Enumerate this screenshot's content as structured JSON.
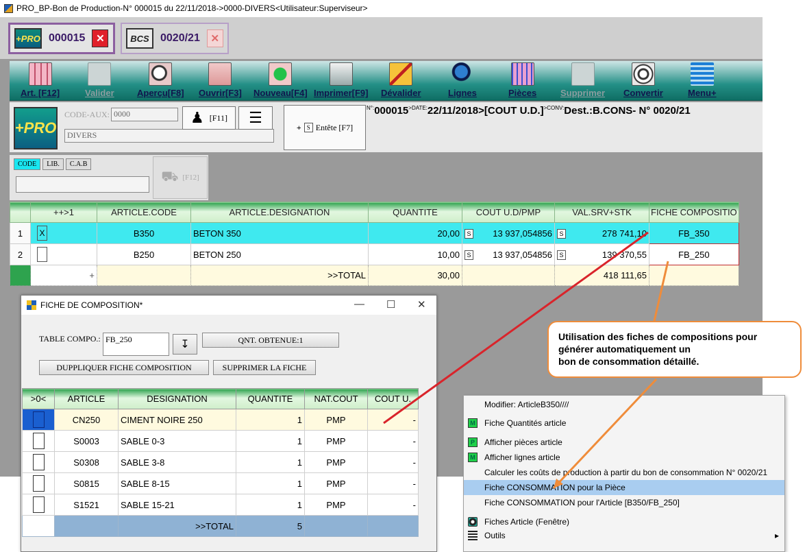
{
  "window_title": "PRO_BP-Bon de Production-N° 000015 du 22/11/2018->0000-DIVERS<Utilisateur:Superviseur>",
  "doc_tabs": [
    {
      "badge": "+PRO",
      "number": "000015",
      "close": "✕"
    },
    {
      "badge": "BCS",
      "number": "0020/21",
      "close": "✕"
    }
  ],
  "toolbar": [
    {
      "label": "Art. [F12]",
      "icon": "article-grid-icon",
      "disabled": false
    },
    {
      "label": "Valider",
      "icon": "validate-icon",
      "disabled": true
    },
    {
      "label": "Aperçu[F8]",
      "icon": "preview-magnifier-icon",
      "disabled": false
    },
    {
      "label": "Ouvrir[F3]",
      "icon": "open-arrow-icon",
      "disabled": false
    },
    {
      "label": "Nouveau[F4]",
      "icon": "new-plus-icon",
      "disabled": false
    },
    {
      "label": "Imprimer[F9]",
      "icon": "printer-icon",
      "disabled": false
    },
    {
      "label": "Dévalider",
      "icon": "unvalidate-icon",
      "disabled": false
    },
    {
      "label": "Lignes",
      "icon": "magnifier-icon",
      "disabled": false
    },
    {
      "label": "Pièces",
      "icon": "grid-table-icon",
      "disabled": false
    },
    {
      "label": "Supprimer",
      "icon": "delete-icon",
      "disabled": true
    },
    {
      "label": "Convertir",
      "icon": "convert-icon",
      "disabled": false
    },
    {
      "label": "Menu+",
      "icon": "menu-lines-icon",
      "disabled": false
    }
  ],
  "header": {
    "logo": "+PRO",
    "code_aux_label": "CODE-AUX:",
    "code_aux_value": "0000",
    "client_name": "DIVERS",
    "f11_label": "[F11]",
    "entete_label": "Entête [F7]",
    "s_label": "S",
    "plus_label": "+"
  },
  "info_line": {
    "no_label": "N°:",
    "no_value": "000015",
    "date_label": ">DATE:",
    "date_value": "22/11/2018",
    "cost_label": ">[COUT U.D.]",
    "conv_label": ">CONV:",
    "conv_value": "Dest.:B.CONS- N° 0020/21"
  },
  "filter": {
    "tabs": [
      "CODE",
      "LIB.",
      "C.A.B"
    ],
    "active": "CODE",
    "f12_label": "[F12]"
  },
  "grid": {
    "headers": [
      "",
      "++>1",
      "ARTICLE.CODE",
      "ARTICLE.DESIGNATION",
      "QUANTITE",
      "COUT U.D/PMP",
      "VAL.SRV+STK",
      "FICHE COMPOSITIO"
    ],
    "rows": [
      {
        "num": "1",
        "check": "X",
        "code": "B350",
        "designation": "BETON 350",
        "quantite": "20,00",
        "cout": "13 937,054856",
        "val": "278 741,10",
        "fiche": "FB_350"
      },
      {
        "num": "2",
        "check": "",
        "code": "B250",
        "designation": "BETON 250",
        "quantite": "10,00",
        "cout": "13 937,054856",
        "val": "139 370,55",
        "fiche": "FB_250"
      }
    ],
    "total": {
      "label": ">>TOTAL",
      "quantite": "30,00",
      "val": "418 111,65"
    },
    "s_mark": "S"
  },
  "compo_window": {
    "title": "FICHE DE COMPOSITION*",
    "min": "—",
    "max": "☐",
    "close": "✕",
    "table_label": "TABLE COMPO.:",
    "table_value": "FB_250",
    "qnt_obtenue": "QNT. OBTENUE:1",
    "dup_button": "DUPPLIQUER FICHE COMPOSITION",
    "del_button": "SUPPRIMER LA FICHE",
    "headers": [
      ">0<",
      "ARTICLE",
      "DESIGNATION",
      "QUANTITE",
      "NAT.COUT",
      "COUT U."
    ],
    "rows": [
      {
        "article": "CN250",
        "designation": "CIMENT NOIRE 250",
        "quantite": "1",
        "nat": "PMP",
        "cout": "-"
      },
      {
        "article": "S0003",
        "designation": "SABLE 0-3",
        "quantite": "1",
        "nat": "PMP",
        "cout": "-"
      },
      {
        "article": "S0308",
        "designation": "SABLE 3-8",
        "quantite": "1",
        "nat": "PMP",
        "cout": "-"
      },
      {
        "article": "S0815",
        "designation": "SABLE 8-15",
        "quantite": "1",
        "nat": "PMP",
        "cout": "-"
      },
      {
        "article": "S1521",
        "designation": "SABLE 15-21",
        "quantite": "1",
        "nat": "PMP",
        "cout": "-"
      }
    ],
    "total_label": ">>TOTAL",
    "total_value": "5"
  },
  "callout": "Utilisation des fiches de compositions pour\ngénérer automatiquement un\n bon de consommation détaillé.",
  "context_menu": [
    {
      "label": "Modifier: ArticleB350////",
      "icon": ""
    },
    {
      "label": "Fiche Quantités article",
      "icon": "M"
    },
    {
      "label": "Afficher pièces article",
      "icon": "P"
    },
    {
      "label": "Afficher lignes article",
      "icon": "M"
    },
    {
      "label": "Calculer les coûts de production à partir du bon de consommation N° 0020/21",
      "icon": ""
    },
    {
      "label": "Fiche CONSOMMATION pour la Pièce",
      "icon": "",
      "highlight": true
    },
    {
      "label": "Fiche CONSOMMATION pour l'Article [B350/FB_250]",
      "icon": ""
    },
    {
      "label": "Fiches Article (Fenêtre)",
      "icon": "eye"
    },
    {
      "label": "Outils",
      "icon": "lines",
      "submenu": "▸"
    }
  ],
  "colors": {
    "accent_teal": "#238f86",
    "selection_cyan": "#3fe9ef",
    "callout_orange": "#ef8c3a",
    "arrow_red": "#d9242b"
  }
}
